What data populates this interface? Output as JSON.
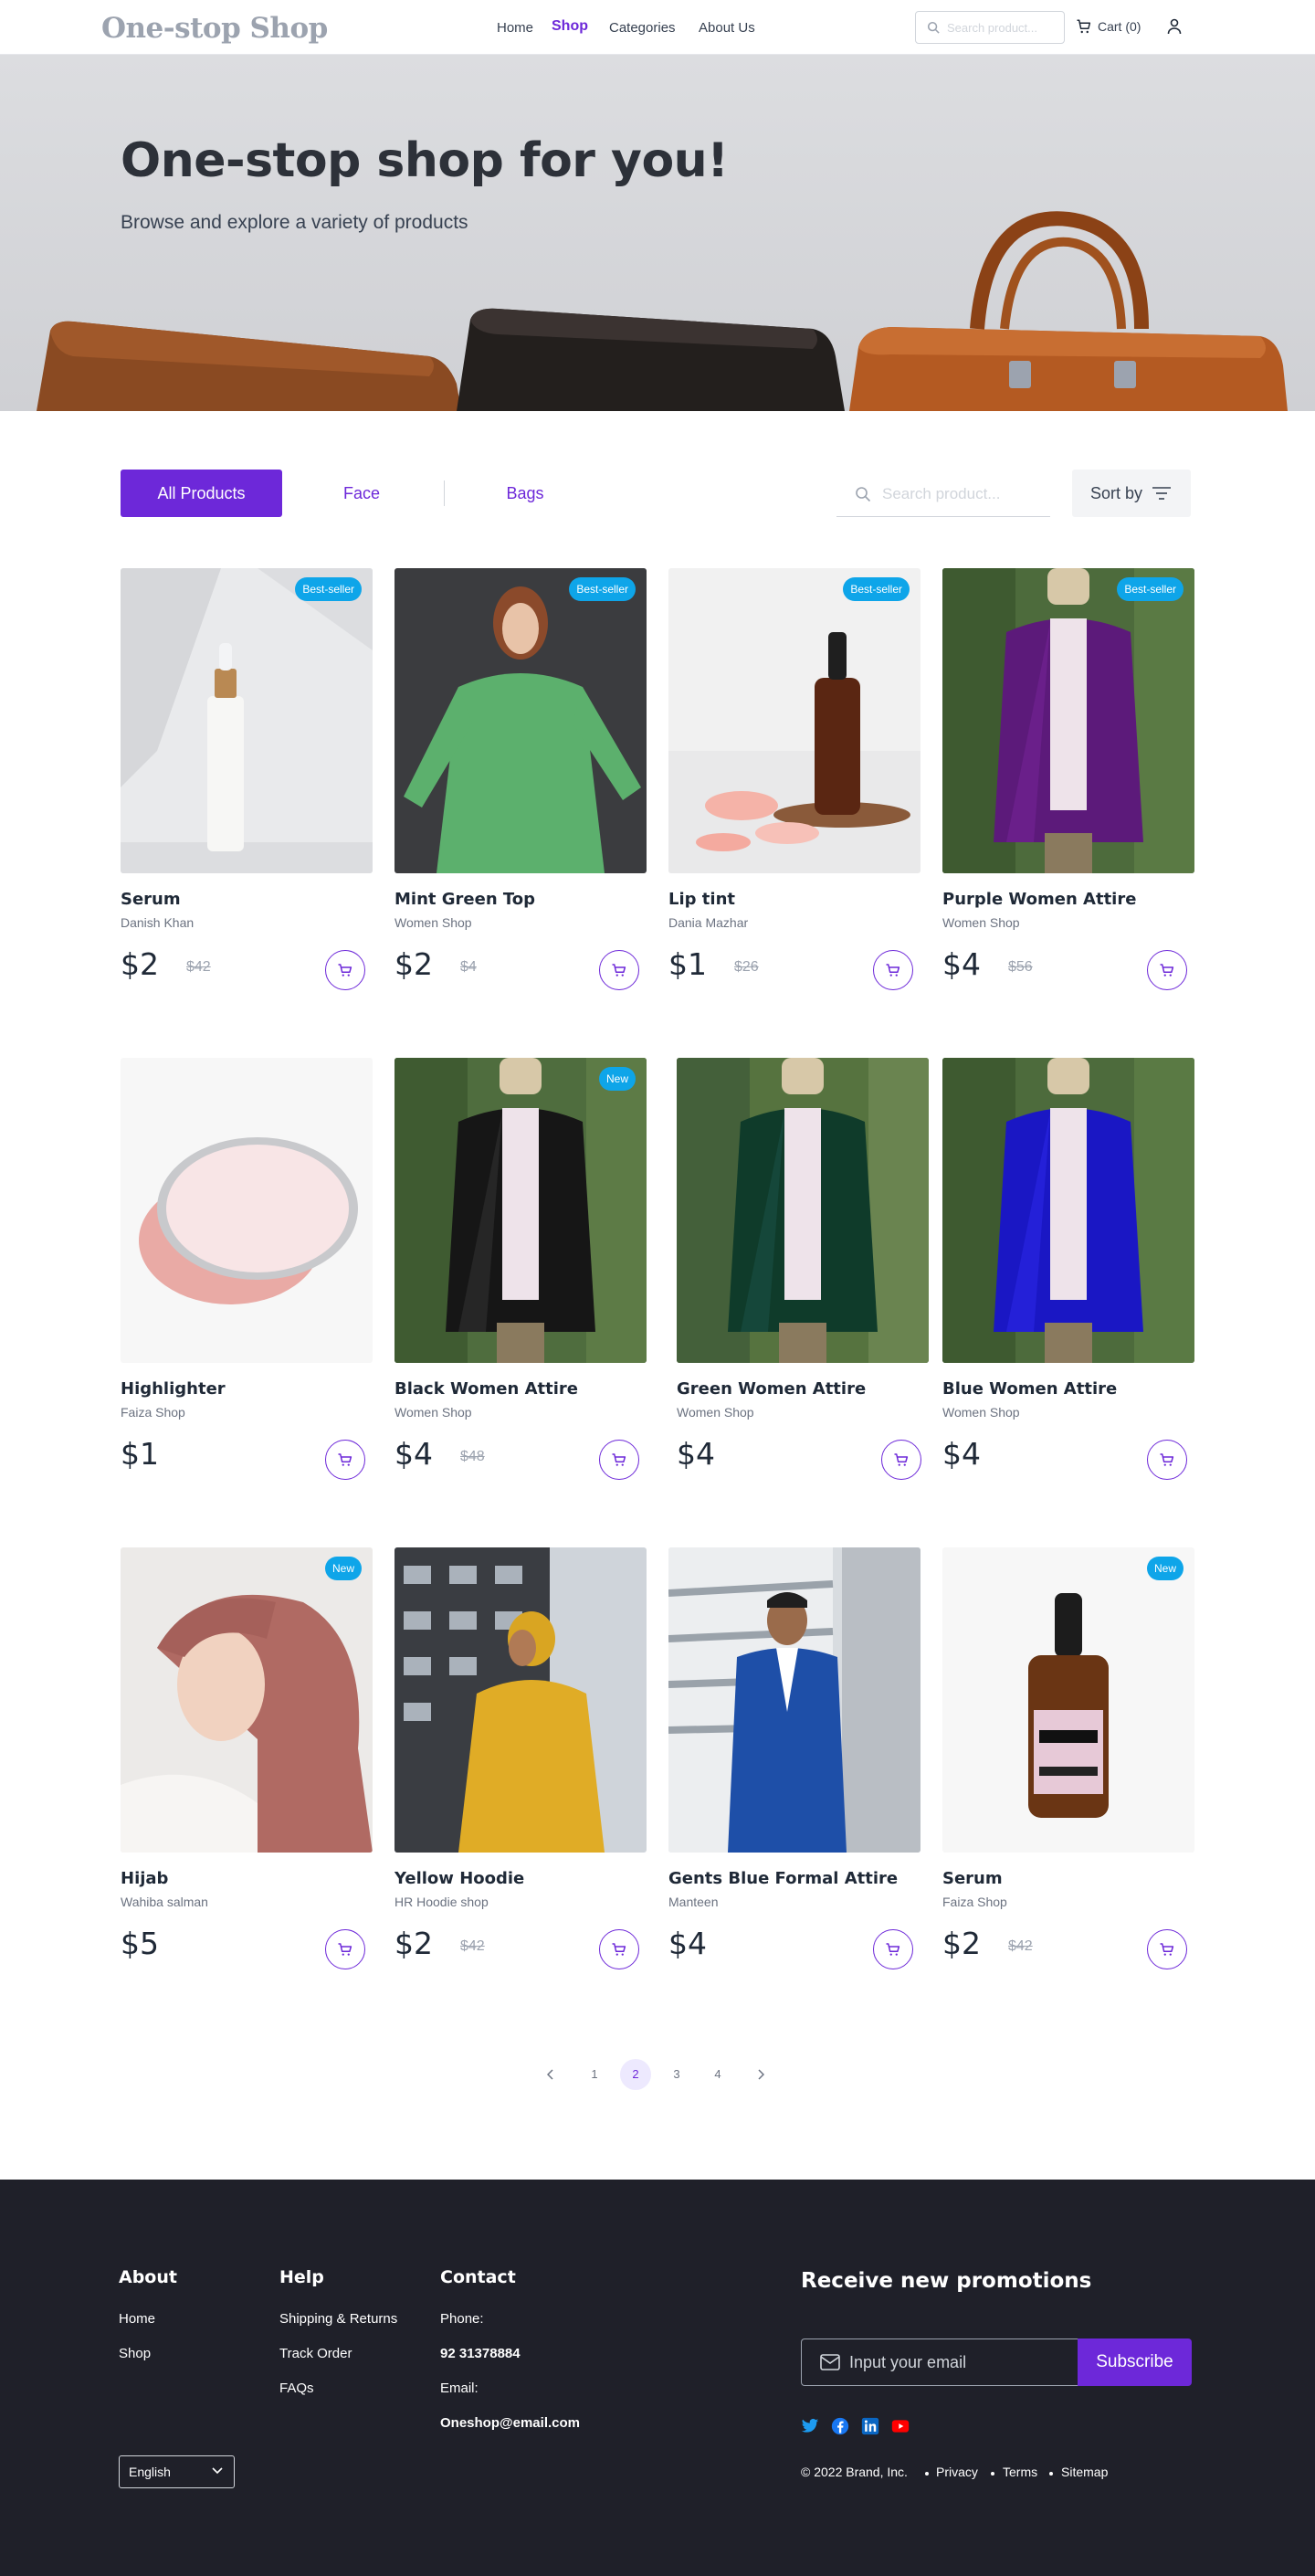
{
  "nav": {
    "logo": "One-stop Shop",
    "links": [
      "Home",
      "Shop",
      "Categories",
      "About Us"
    ],
    "active": "Shop",
    "search_placeholder": "Search product...",
    "cart_label": "Cart (0)"
  },
  "hero": {
    "title": "One-stop shop for you!",
    "subtitle": "Browse and  explore a variety of products"
  },
  "filters": {
    "tabs": [
      "All Products",
      "Face",
      "Bags"
    ],
    "active_tab": "All Products",
    "search_placeholder": "Search product...",
    "sort_label": "Sort by"
  },
  "products": [
    {
      "name": "Serum",
      "seller": "Danish Khan",
      "price": "$2",
      "old_price": "$42",
      "badge": "Best-seller"
    },
    {
      "name": "Mint Green Top",
      "seller": "Women Shop",
      "price": "$2",
      "old_price": "$4",
      "badge": "Best-seller"
    },
    {
      "name": "Lip tint",
      "seller": "Dania Mazhar",
      "price": "$1",
      "old_price": "$26",
      "badge": "Best-seller"
    },
    {
      "name": "Purple Women Attire",
      "seller": "Women Shop",
      "price": "$4",
      "old_price": "$56",
      "badge": "Best-seller"
    },
    {
      "name": "Highlighter",
      "seller": "Faiza Shop",
      "price": "$1",
      "old_price": "",
      "badge": ""
    },
    {
      "name": "Black Women Attire",
      "seller": "Women Shop",
      "price": "$4",
      "old_price": "$48",
      "badge": "New"
    },
    {
      "name": "Green Women Attire",
      "seller": "Women Shop",
      "price": "$4",
      "old_price": "",
      "badge": ""
    },
    {
      "name": "Blue Women Attire",
      "seller": "Women Shop",
      "price": "$4",
      "old_price": "",
      "badge": ""
    },
    {
      "name": "Hijab",
      "seller": "Wahiba  salman",
      "price": "$5",
      "old_price": "",
      "badge": "New"
    },
    {
      "name": "Yellow Hoodie",
      "seller": "HR Hoodie shop",
      "price": "$2",
      "old_price": "$42",
      "badge": ""
    },
    {
      "name": "Gents Blue Formal Attire",
      "seller": "Manteen",
      "price": "$4",
      "old_price": "",
      "badge": ""
    },
    {
      "name": "Serum",
      "seller": "Faiza Shop",
      "price": "$2",
      "old_price": "$42",
      "badge": "New"
    }
  ],
  "pagination": {
    "pages": [
      "1",
      "2",
      "3",
      "4"
    ],
    "current": "2"
  },
  "footer": {
    "about": {
      "title": "About",
      "links": [
        "Home",
        "Shop"
      ]
    },
    "help": {
      "title": "Help",
      "links": [
        "Shipping & Returns",
        "Track Order",
        "FAQs"
      ]
    },
    "contact": {
      "title": "Contact",
      "phone_label": "Phone:",
      "phone": "92 31378884",
      "email_label": "Email:",
      "email": "Oneshop@email.com"
    },
    "promo_title": "Receive new promotions",
    "email_placeholder": "Input your email",
    "subscribe_label": "Subscribe",
    "copyright": "© 2022 Brand, Inc.",
    "legal_links": [
      "Privacy",
      "Terms",
      "Sitemap"
    ],
    "language": "English",
    "social_icons": [
      "twitter-icon",
      "facebook-icon",
      "linkedin-icon",
      "youtube-icon"
    ]
  },
  "colors": {
    "accent": "#6d28d9",
    "badge": "#0ea5e9",
    "footer_bg": "#1f2029"
  }
}
